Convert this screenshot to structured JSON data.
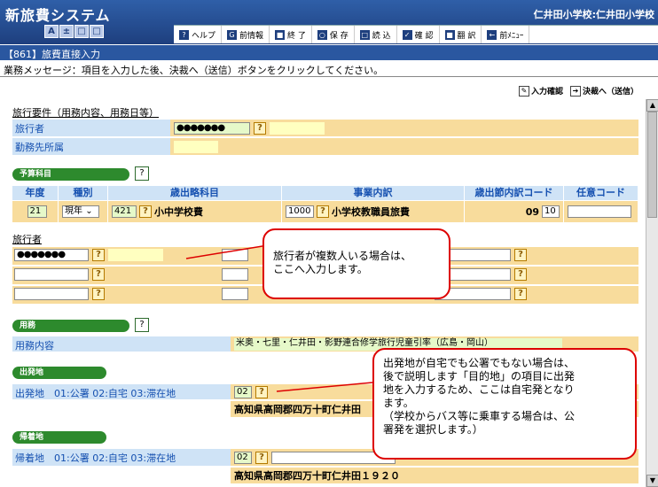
{
  "app": {
    "title": "新旅費システム",
    "school": "仁井田小学校:仁井田小学校",
    "size_buttons": [
      "A",
      "±",
      "□",
      "□"
    ]
  },
  "toolbar": [
    {
      "icon": "?",
      "label": "ヘルプ"
    },
    {
      "icon": "G",
      "label": "前情報"
    },
    {
      "icon": "■",
      "label": "終 了"
    },
    {
      "icon": "○",
      "label": "保 存"
    },
    {
      "icon": "□",
      "label": "読 込"
    },
    {
      "icon": "✓",
      "label": "確 認"
    },
    {
      "icon": "■",
      "label": "翻 訳"
    },
    {
      "icon": "←",
      "label": "前ﾒﾆｭｰ"
    }
  ],
  "screen_id": "【861】旅費直接入力",
  "message": "業務メッセージ：項目を入力した後、決裁へ（送信）ボタンをクリックしてください。",
  "actions": {
    "confirm": "入力確認",
    "submit": "決裁へ（送信）"
  },
  "travel_req": {
    "heading": "旅行要件（用務内容、用務日等）",
    "traveler_label": "旅行者",
    "traveler_value": "●●●●●●●",
    "office_label": "勤務先所属"
  },
  "budget": {
    "pill": "予算科目",
    "headers": [
      "年度",
      "種別",
      "歳出略科目",
      "事業内訳",
      "歳出節内訳コード",
      "任意コード"
    ],
    "year": "21",
    "kind": "現年",
    "subject_code": "421",
    "subject_name": "小中学校費",
    "project_code": "1000",
    "project_name": "小学校教職員旅費",
    "section_code": "09",
    "section_sub": "10"
  },
  "travelers": {
    "heading": "旅行者",
    "first": "●●●●●●●"
  },
  "purpose": {
    "pill": "用務",
    "label": "用務内容",
    "value": "米奥・七里・仁井田・影野連合修学旅行児童引率（広島・岡山）"
  },
  "departure": {
    "pill": "出発地",
    "label": "出発地　01:公署 02:自宅 03:滞在地",
    "code": "02",
    "address": "高知県高岡郡四万十町仁井田"
  },
  "return_place": {
    "pill": "帰着地",
    "label": "帰着地　01:公署 02:自宅 03:滞在地",
    "code": "02",
    "address": "高知県高岡郡四万十町仁井田１９２０"
  },
  "callouts": {
    "c1": [
      "旅行者が複数人いる場合は、",
      "ここへ入力します。"
    ],
    "c2": [
      "出発地が自宅でも公署でもない場合は、",
      "後で説明します「目的地」の項目に出発",
      "地を入力するため、ここは自宅発となり",
      "ます。",
      "（学校からバス等に乗車する場合は、公",
      "署発を選択します。）"
    ]
  },
  "colors": {
    "header": "#2f5fa8",
    "label_bg": "#cfe3f6",
    "value_bg": "#f8dc9c",
    "pill": "#2d8a2d",
    "callout_border": "#dd0000"
  }
}
